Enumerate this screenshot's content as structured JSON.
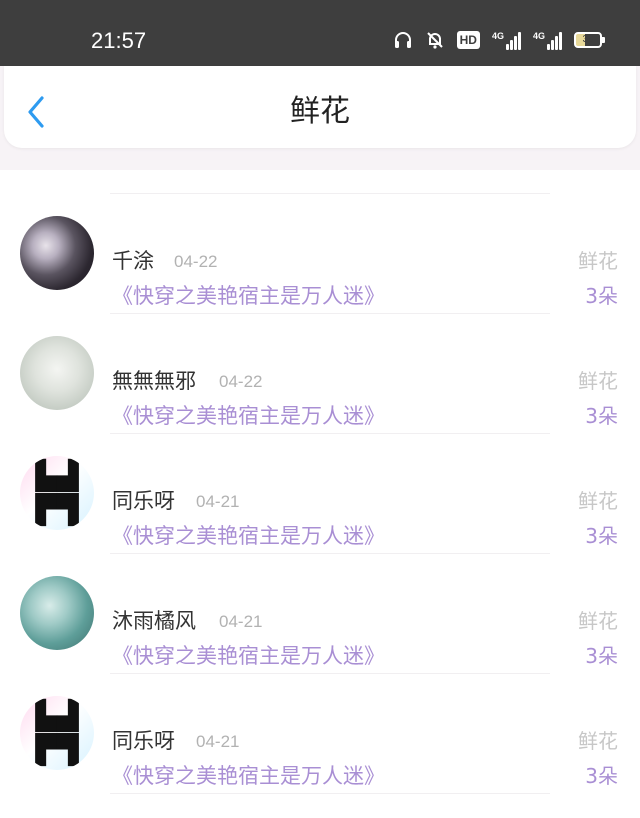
{
  "status_bar": {
    "time": "21:57",
    "hd_label": "HD",
    "net1": "4G",
    "net2": "4G",
    "battery": "38"
  },
  "header": {
    "title": "鲜花",
    "back_icon": "chevron-left-icon",
    "accent_color": "#2e9bf0"
  },
  "colors": {
    "book": "#a98fd4",
    "muted": "#b2b2b2"
  },
  "records": [
    {
      "name": "千涂",
      "date": "04-22",
      "book": "《快穿之美艳宿主是万人迷》",
      "gift_type": "鲜花",
      "count": "3朵"
    },
    {
      "name": "無無無邪",
      "date": "04-22",
      "book": "《快穿之美艳宿主是万人迷》",
      "gift_type": "鲜花",
      "count": "3朵"
    },
    {
      "name": "同乐呀",
      "date": "04-21",
      "book": "《快穿之美艳宿主是万人迷》",
      "gift_type": "鲜花",
      "count": "3朵"
    },
    {
      "name": "沐雨橘风",
      "date": "04-21",
      "book": "《快穿之美艳宿主是万人迷》",
      "gift_type": "鲜花",
      "count": "3朵"
    },
    {
      "name": "同乐呀",
      "date": "04-21",
      "book": "《快穿之美艳宿主是万人迷》",
      "gift_type": "鲜花",
      "count": "3朵"
    }
  ]
}
